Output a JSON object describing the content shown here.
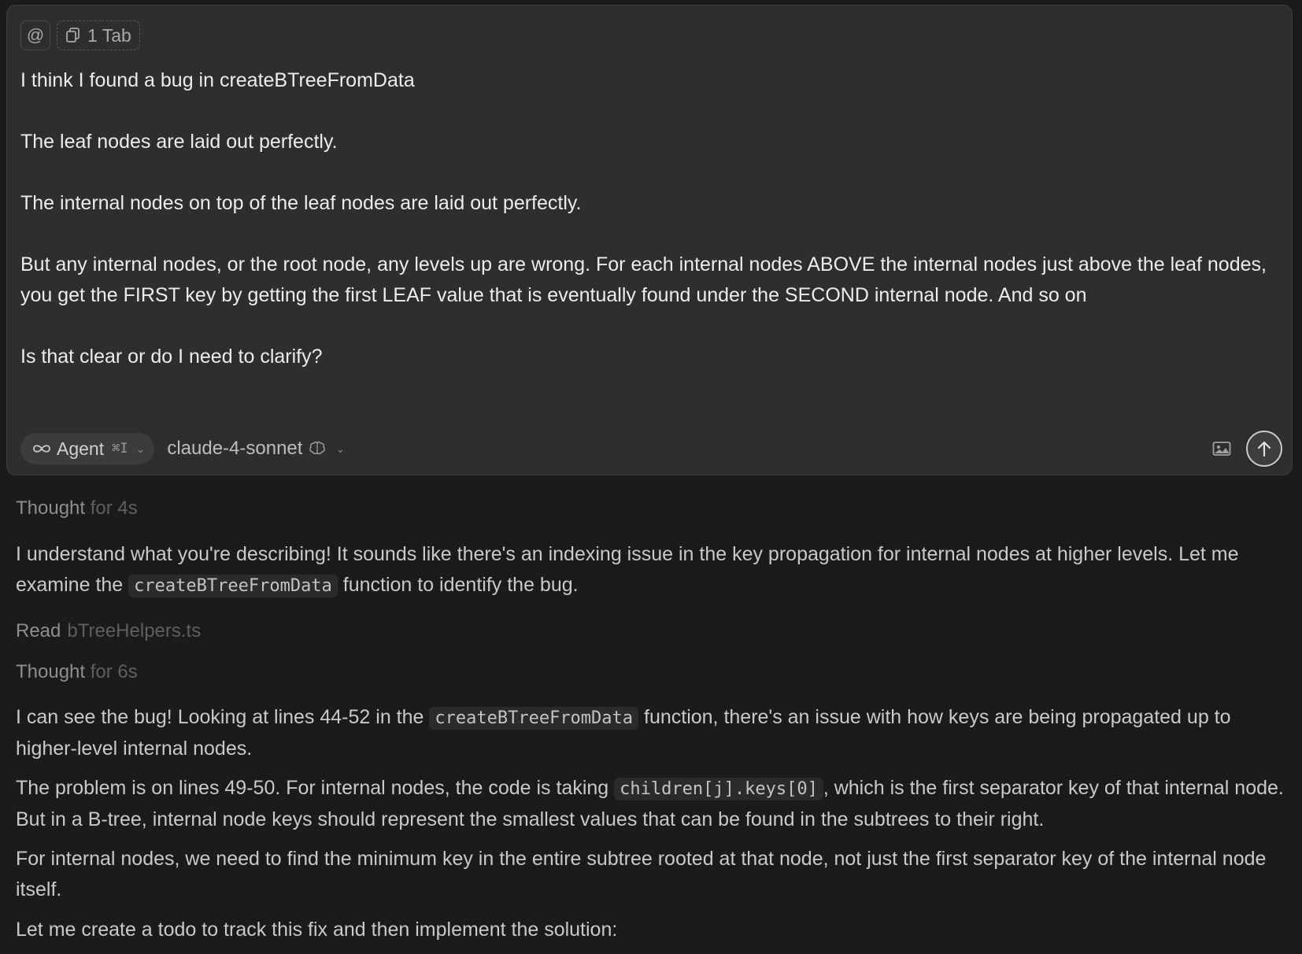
{
  "composer": {
    "mention_icon": "at-icon",
    "tab_chip_icon": "copy-icon",
    "tab_chip_label": "1 Tab",
    "message_paragraphs": [
      "I think I found a bug in createBTreeFromData",
      "The leaf nodes are laid out perfectly.",
      "The internal nodes on top of the leaf nodes are laid out perfectly.",
      "But any internal nodes, or the root node, any levels up are wrong. For each internal nodes ABOVE the internal nodes just above the leaf nodes, you get the FIRST key by getting the first LEAF value that is eventually found under the SECOND internal node. And so on",
      "Is that clear or do I need to clarify?"
    ],
    "agent_icon": "infinity-icon",
    "agent_label": "Agent",
    "agent_shortcut": "⌘I",
    "model_label": "claude-4-sonnet",
    "model_icon": "brain-icon",
    "image_icon": "image-icon",
    "send_icon": "arrow-up-icon"
  },
  "transcript": {
    "thought1": {
      "label": "Thought",
      "duration": "for 4s"
    },
    "para1": {
      "before": "I understand what you're describing! It sounds like there's an indexing issue in the key propagation for internal nodes at higher levels. Let me examine the ",
      "code": "createBTreeFromData",
      "after": " function to identify the bug."
    },
    "read": {
      "label": "Read",
      "file": "bTreeHelpers.ts"
    },
    "thought2": {
      "label": "Thought",
      "duration": "for 6s"
    },
    "para2": {
      "before": "I can see the bug! Looking at lines 44-52 in the ",
      "code": "createBTreeFromData",
      "after": " function, there's an issue with how keys are being propagated up to higher-level internal nodes."
    },
    "para3": {
      "before": "The problem is on lines 49-50. For internal nodes, the code is taking ",
      "code": "children[j].keys[0]",
      "after": ", which is the first separator key of that internal node. But in a B-tree, internal node keys should represent the smallest values that can be found in the subtrees to their right."
    },
    "para4": "For internal nodes, we need to find the minimum key in the entire subtree rooted at that node, not just the first separator key of the internal node itself.",
    "para5": "Let me create a todo to track this fix and then implement the solution:"
  }
}
